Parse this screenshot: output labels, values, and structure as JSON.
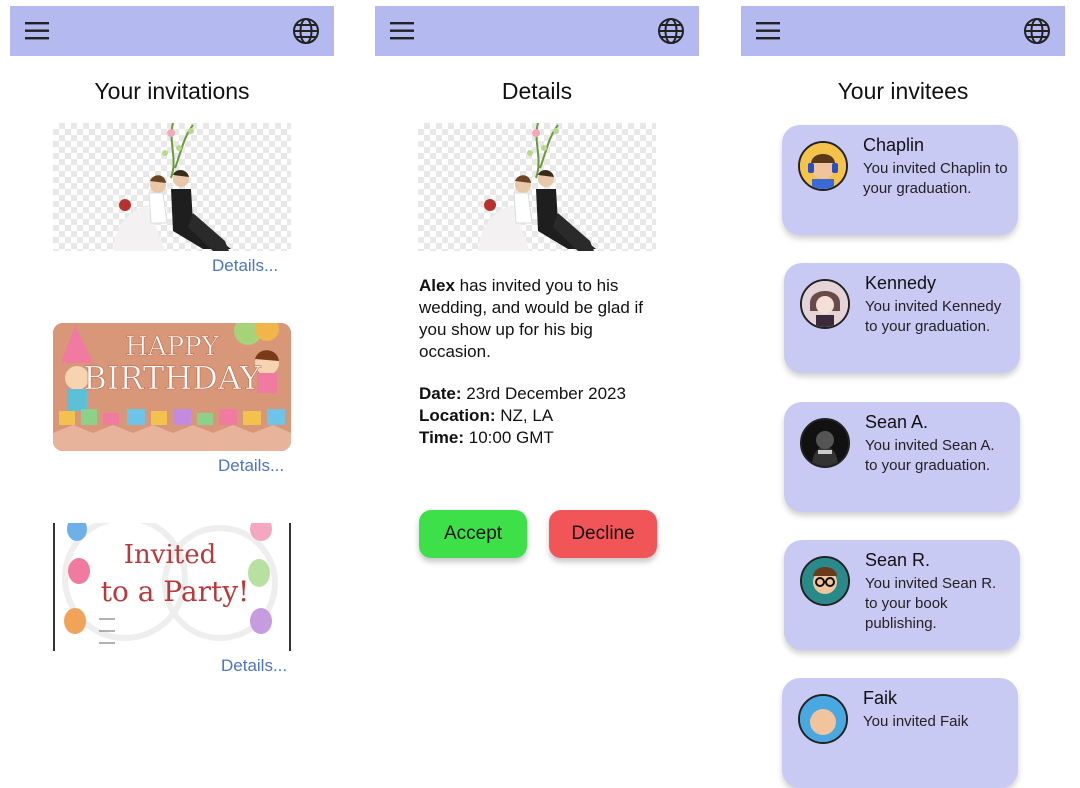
{
  "screens": {
    "invitations": {
      "title": "Your invitations",
      "cards": [
        {
          "image": "wedding-couple-illustration",
          "details_label": "Details..."
        },
        {
          "image": "happy-birthday-card",
          "banner_text": "HAPPY BIRTHDAY",
          "details_label": "Details..."
        },
        {
          "image": "party-invitation-card",
          "banner_line1": "Invited",
          "banner_line2": "to a Party!",
          "details_label": "Details..."
        }
      ]
    },
    "details": {
      "title": "Details",
      "image": "wedding-couple-illustration",
      "host": "Alex",
      "message": " has invited you to his wedding, and would be glad if you show up for his big occasion.",
      "date_label": "Date:",
      "date_value": " 23rd December 2023",
      "location_label": "Location:",
      "location_value": " NZ, LA",
      "time_label": "Time:",
      "time_value": " 10:00 GMT",
      "accept_label": "Accept",
      "decline_label": "Decline"
    },
    "invitees": {
      "title": "Your invitees",
      "items": [
        {
          "name": "Chaplin",
          "text": "You invited Chaplin to your graduation.",
          "avatar": "headphones-avatar"
        },
        {
          "name": "Kennedy",
          "text": "You invited Kennedy to your graduation.",
          "avatar": "anime-avatar"
        },
        {
          "name": "Sean A.",
          "text": "You invited Sean A.  to your graduation.",
          "avatar": "dark-hooded-avatar"
        },
        {
          "name": "Sean R.",
          "text": "You invited Sean R.  to your book publishing.",
          "avatar": "glasses-avatar"
        },
        {
          "name": "Faik",
          "text": "You invited Faik",
          "avatar": "bald-avatar"
        }
      ]
    }
  },
  "icons": {
    "menu": "hamburger-menu-icon",
    "language": "globe-icon"
  },
  "colors": {
    "topbar": "#b4baf0",
    "card": "#c8caf4",
    "link": "#4d74c4",
    "accept": "#3ee04a",
    "decline": "#f25558"
  }
}
